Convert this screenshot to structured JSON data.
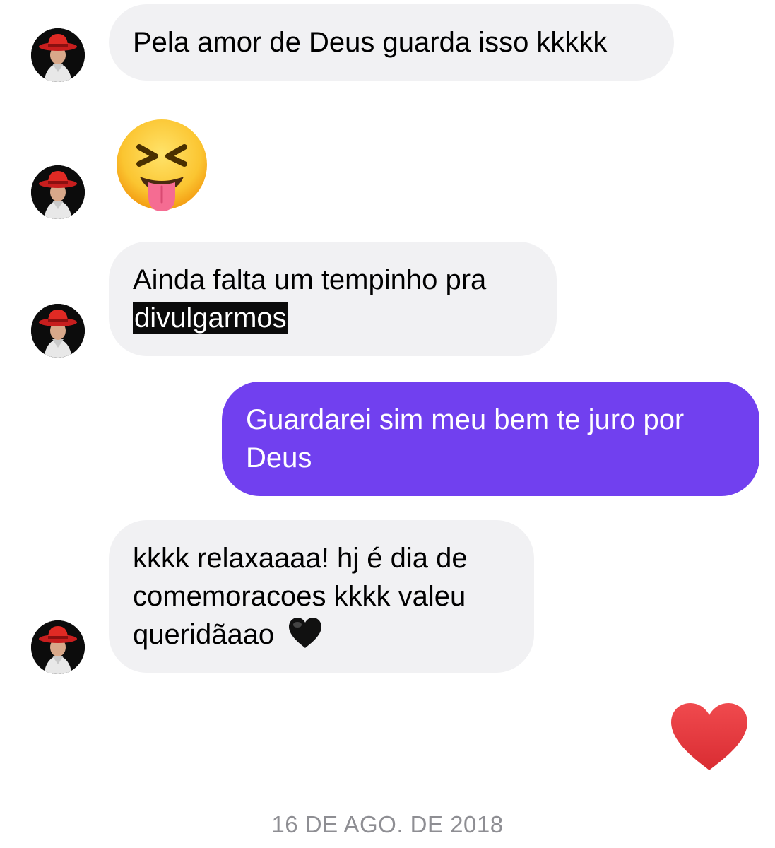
{
  "messages": [
    {
      "sender": "other",
      "text": "Pela amor de Deus guarda isso kkkkk"
    },
    {
      "sender": "other",
      "emoji": "squinting-face-with-tongue-icon"
    },
    {
      "sender": "other",
      "line1": "Ainda falta um tempinho pra",
      "highlighted": "divulgarmos"
    },
    {
      "sender": "me",
      "text": "Guardarei sim meu bem te juro por Deus"
    },
    {
      "sender": "other",
      "text": "kkkk relaxaaaa! hj é dia de comemoracoes kkkk valeu queridãaao",
      "trailing_emoji": "black-heart-icon"
    },
    {
      "sender": "me",
      "emoji": "red-heart-icon"
    }
  ],
  "date_separator": "16 DE AGO. DE 2018",
  "colors": {
    "incoming_bubble": "#f1f1f3",
    "outgoing_bubble": "#7140ef",
    "heart": "#e53a3e",
    "date_text": "#8e8e93"
  }
}
